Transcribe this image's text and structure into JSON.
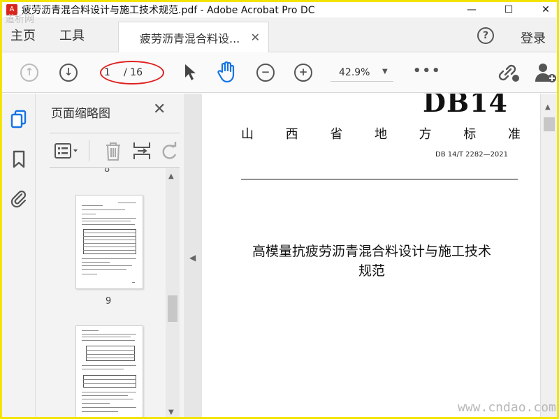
{
  "window": {
    "title": "疲劳沥青混合料设计与施工技术规范.pdf - Adobe Acrobat Pro DC",
    "minimize": "—",
    "maximize": "☐",
    "close": "✕",
    "app_icon": "pdf-icon"
  },
  "menu": {
    "home": "主页",
    "tools": "工具",
    "tab_label": "疲劳沥青混合料设...",
    "tab_close": "✕",
    "help": "?",
    "login": "登录"
  },
  "toolbar": {
    "prev_page": "↑",
    "next_page": "↓",
    "page_current": "1",
    "page_total": "/ 16",
    "zoom_out": "−",
    "zoom_in": "+",
    "zoom_value": "42.9%",
    "zoom_caret": "▼",
    "more": "•••",
    "highlight_color": "#e02020"
  },
  "panel": {
    "title": "页面缩略图",
    "close": "✕",
    "partial_label": "8",
    "thumbnails": [
      {
        "label": "9"
      },
      {
        "label": ""
      }
    ]
  },
  "collapse_arrow": "◀",
  "scroll": {
    "up": "▲",
    "down": "▼"
  },
  "document": {
    "code": "DB14",
    "province": [
      "山",
      "西",
      "省",
      "地",
      "方",
      "标",
      "准"
    ],
    "standard_number": "DB 14/T  2282—2021",
    "title_line1": "高模量抗疲劳沥青混合料设计与施工技术",
    "title_line2": "规范"
  },
  "watermarks": {
    "top_left": "道析网",
    "bottom_right": "www.cndao.com"
  },
  "colors": {
    "frame_border": "#f2e400",
    "accent_blue": "#1473e6"
  }
}
